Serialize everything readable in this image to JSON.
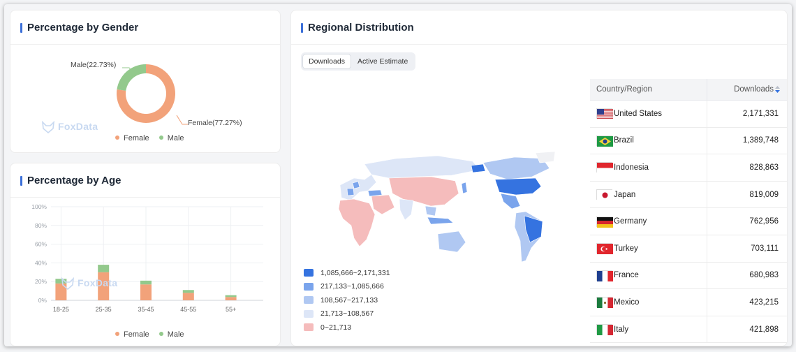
{
  "gender_card": {
    "title": "Percentage by Gender",
    "male_label": "Male(22.73%)",
    "female_label": "Female(77.27%)",
    "watermark": "FoxData",
    "legend": [
      "Female",
      "Male"
    ],
    "chart_data": {
      "type": "pie",
      "categories": [
        "Female",
        "Male"
      ],
      "values": [
        77.27,
        22.73
      ],
      "colors": [
        "#f2a27a",
        "#93c98c"
      ]
    }
  },
  "age_card": {
    "title": "Percentage by Age",
    "watermark": "FoxData",
    "legend": [
      "Female",
      "Male"
    ],
    "chart_data": {
      "type": "bar",
      "categories": [
        "18-25",
        "25-35",
        "35-45",
        "45-55",
        "55+"
      ],
      "series": [
        {
          "name": "Female",
          "values": [
            18,
            30,
            17,
            8,
            3.5
          ],
          "color": "#f2a27a"
        },
        {
          "name": "Male",
          "values": [
            5,
            8,
            4,
            3,
            2
          ],
          "color": "#93c98c"
        }
      ],
      "yticks": [
        "100%",
        "80%",
        "60%",
        "40%",
        "20%",
        "0%"
      ],
      "ylim": [
        0,
        100
      ],
      "stacked": true
    }
  },
  "regional_card": {
    "title": "Regional Distribution",
    "tabs": [
      {
        "label": "Downloads",
        "active": true
      },
      {
        "label": "Active Estimate",
        "active": false
      }
    ],
    "legend": [
      {
        "label": "1,085,666~2,171,331",
        "color": "#3573e0"
      },
      {
        "label": "217,133~1,085,666",
        "color": "#7aa4ec"
      },
      {
        "label": "108,567~217,133",
        "color": "#b0c8f2"
      },
      {
        "label": "21,713~108,567",
        "color": "#dde6f7"
      },
      {
        "label": "0~21,713",
        "color": "#f5bcbc"
      }
    ],
    "table": {
      "col_country": "Country/Region",
      "col_downloads": "Downloads",
      "rows": [
        {
          "country": "United States",
          "downloads": "2,171,331",
          "flag": "us"
        },
        {
          "country": "Brazil",
          "downloads": "1,389,748",
          "flag": "br"
        },
        {
          "country": "Indonesia",
          "downloads": "828,863",
          "flag": "id"
        },
        {
          "country": "Japan",
          "downloads": "819,009",
          "flag": "jp"
        },
        {
          "country": "Germany",
          "downloads": "762,956",
          "flag": "de"
        },
        {
          "country": "Turkey",
          "downloads": "703,111",
          "flag": "tr"
        },
        {
          "country": "France",
          "downloads": "680,983",
          "flag": "fr"
        },
        {
          "country": "Mexico",
          "downloads": "423,215",
          "flag": "mx"
        },
        {
          "country": "Italy",
          "downloads": "421,898",
          "flag": "it"
        }
      ]
    }
  }
}
